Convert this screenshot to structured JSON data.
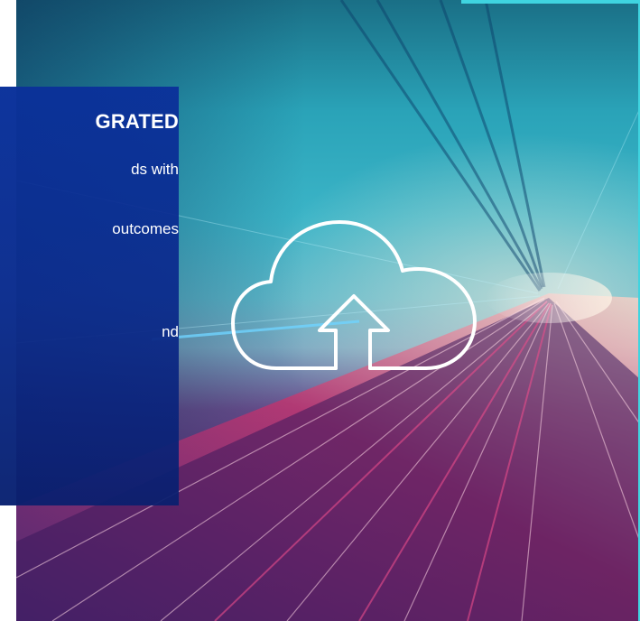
{
  "hero": {
    "icon": "cloud-upload-icon"
  },
  "panel": {
    "title": "GRATED",
    "lines": [
      "ds with",
      "outcomes",
      "nd"
    ]
  },
  "colors": {
    "panel_blue": "#0a2f9a",
    "accent_cyan": "#3fd4e0",
    "hero_teal": "#2aa3b8",
    "hero_magenta": "#c2346e",
    "hero_purple": "#5a2f78"
  }
}
